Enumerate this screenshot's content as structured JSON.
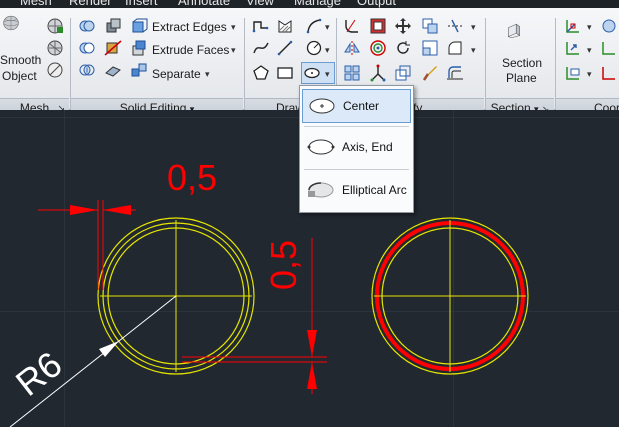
{
  "tabs": [
    "Mesh",
    "Render",
    "Insert",
    "Annotate",
    "View",
    "Manage",
    "Output"
  ],
  "mesh_panel": {
    "smooth_object_line1": "Smooth",
    "smooth_object_line2": "Object",
    "title": "Mesh",
    "launcher": "↘"
  },
  "solid_editing": {
    "title": "Solid Editing",
    "extract_edges": "Extract Edges",
    "extrude_faces": "Extrude Faces",
    "separate": "Separate",
    "dropdown_arrow": "▾"
  },
  "draw_panel": {
    "title": "Draw"
  },
  "modify_panel": {
    "title": "fy"
  },
  "section_panel": {
    "section_plane_line1": "Section",
    "section_plane_line2": "Plane",
    "title": "Section"
  },
  "coordinates_panel": {
    "title": "Coor"
  },
  "ellipse_menu": {
    "items": [
      "Center",
      "Axis, End",
      "Elliptical Arc"
    ],
    "selected": "Center"
  },
  "drawing": {
    "dim_horizontal": "0,5",
    "dim_vertical": "0,5",
    "radius_label": "R6"
  },
  "colors": {
    "canvas": "#212830",
    "geometry": "#e6e600",
    "dimension": "#ff0000",
    "ribbon": "#eef0f3",
    "menu_highlight": "#dbe9f8"
  }
}
